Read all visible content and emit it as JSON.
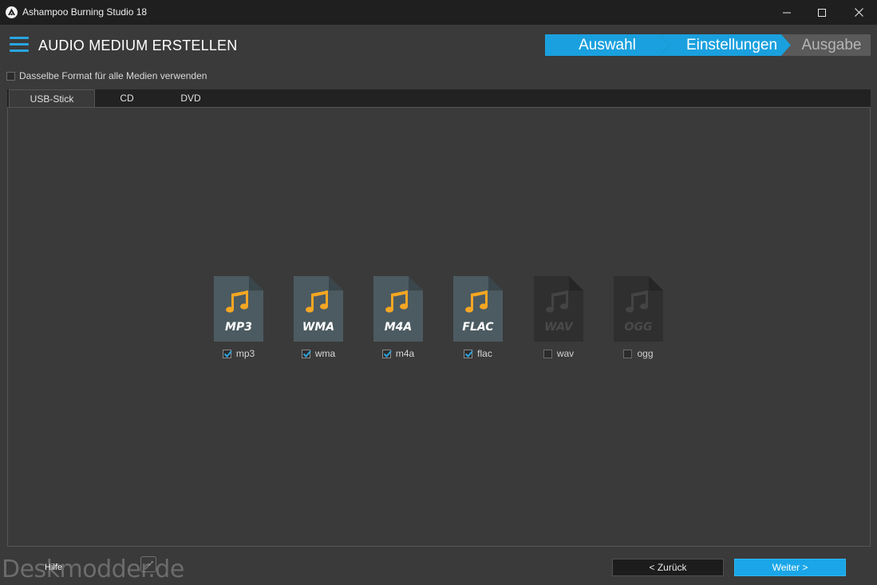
{
  "window": {
    "title": "Ashampoo Burning Studio 18"
  },
  "header": {
    "title": "AUDIO MEDIUM ERSTELLEN"
  },
  "wizard": {
    "steps": [
      {
        "label": "Auswahl",
        "state": "done"
      },
      {
        "label": "Einstellungen",
        "state": "current"
      },
      {
        "label": "Ausgabe",
        "state": "pending"
      }
    ]
  },
  "options": {
    "same_format_label": "Dasselbe Format für alle Medien verwenden",
    "same_format_checked": false
  },
  "tabs": [
    {
      "label": "USB-Stick",
      "active": true
    },
    {
      "label": "CD",
      "active": false
    },
    {
      "label": "DVD",
      "active": false
    }
  ],
  "formats": [
    {
      "icon_label": "MP3",
      "label": "mp3",
      "checked": true
    },
    {
      "icon_label": "WMA",
      "label": "wma",
      "checked": true
    },
    {
      "icon_label": "M4A",
      "label": "m4a",
      "checked": true
    },
    {
      "icon_label": "FLAC",
      "label": "flac",
      "checked": true
    },
    {
      "icon_label": "WAV",
      "label": "wav",
      "checked": false
    },
    {
      "icon_label": "OGG",
      "label": "ogg",
      "checked": false
    }
  ],
  "footer": {
    "help_label": "Hilfe",
    "back_label": "< Zurück",
    "next_label": "Weiter >",
    "watermark": "Deskmodder.de"
  },
  "colors": {
    "accent": "#1aa0de",
    "note_active": "#f5a623",
    "doc_active": "#4c5b61",
    "doc_inactive": "#2f2f2f"
  }
}
